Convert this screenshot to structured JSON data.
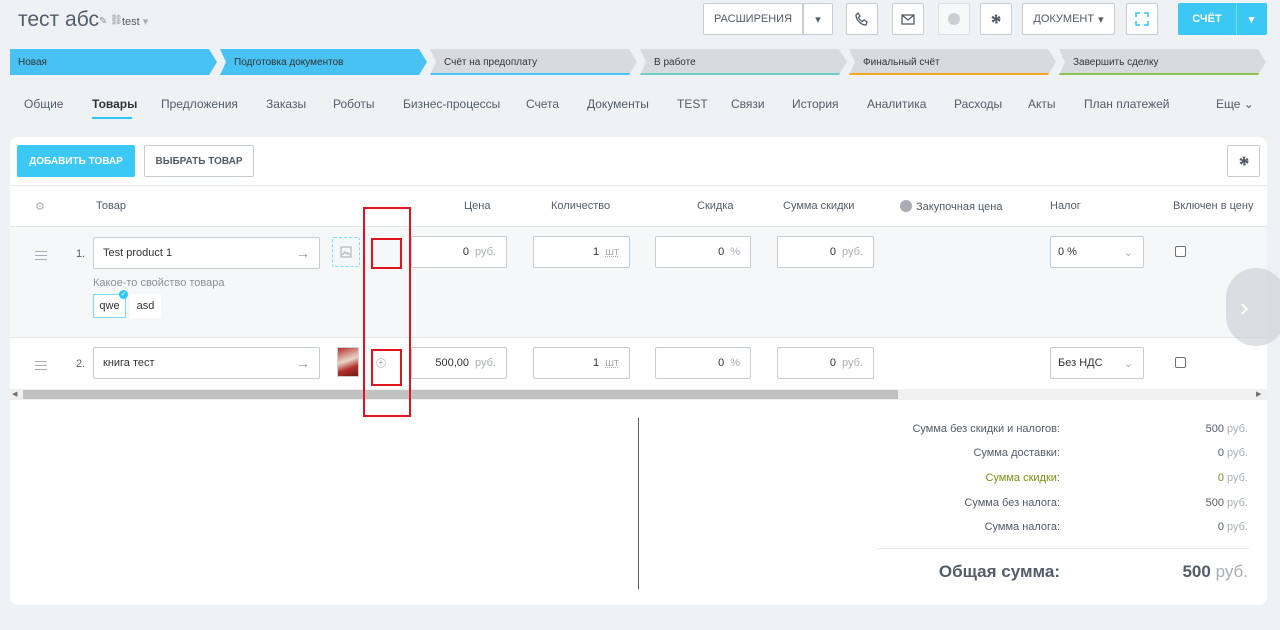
{
  "header": {
    "title": "тест абс",
    "category": "test",
    "extensions_label": "РАСШИРЕНИЯ",
    "document_label": "ДОКУМЕНТ",
    "invoice_label": "СЧЁТ"
  },
  "stages": [
    {
      "label": "Новая",
      "color": "#47c2f3"
    },
    {
      "label": "Подготовка документов",
      "color": "#47c2f3"
    },
    {
      "label": "Счёт на предоплату",
      "color": "#d7dbe0"
    },
    {
      "label": "В работе",
      "color": "#d7dbe0"
    },
    {
      "label": "Финальный счёт",
      "color": "#d7dbe0"
    },
    {
      "label": "Завершить сделку",
      "color": "#d7dbe0"
    }
  ],
  "tabs": [
    "Общие",
    "Товары",
    "Предложения",
    "Заказы",
    "Роботы",
    "Бизнес-процессы",
    "Счета",
    "Документы",
    "TEST",
    "Связи",
    "История",
    "Аналитика",
    "Расходы",
    "Акты",
    "План платежей"
  ],
  "more_tab": "Еще",
  "toolbar": {
    "add_product": "ДОБАВИТЬ ТОВАР",
    "select_product": "ВЫБРАТЬ ТОВАР"
  },
  "columns": {
    "product": "Товар",
    "price": "Цена",
    "quantity": "Количество",
    "discount": "Скидка",
    "discount_sum": "Сумма скидки",
    "purchase_price": "Закупочная цена",
    "tax": "Налог",
    "included": "Включен в цену"
  },
  "rows": [
    {
      "num": "1.",
      "name": "Test product 1",
      "property_label": "Какое-то свойство товара",
      "options": [
        "qwe",
        "asd"
      ],
      "price": "0",
      "price_unit": "руб.",
      "qty": "1",
      "qty_unit": "шт",
      "discount": "0",
      "discount_unit": "%",
      "discount_sum": "0",
      "discount_sum_unit": "руб.",
      "tax": "0 %"
    },
    {
      "num": "2.",
      "name": "книга тест",
      "price": "500,00",
      "price_unit": "руб.",
      "qty": "1",
      "qty_unit": "шт",
      "discount": "0",
      "discount_unit": "%",
      "discount_sum": "0",
      "discount_sum_unit": "руб.",
      "tax": "Без НДС"
    }
  ],
  "summary": {
    "items": [
      {
        "label": "Сумма без скидки и налогов:",
        "value": "500",
        "unit": "руб."
      },
      {
        "label": "Сумма доставки:",
        "value": "0",
        "unit": "руб."
      },
      {
        "label": "Сумма скидки:",
        "value": "0",
        "unit": "руб."
      },
      {
        "label": "Сумма без налога:",
        "value": "500",
        "unit": "руб."
      },
      {
        "label": "Сумма налога:",
        "value": "0",
        "unit": "руб."
      }
    ],
    "total_label": "Общая сумма:",
    "total_value": "500",
    "total_unit": "руб."
  },
  "colors": {
    "accent": "#3bc8f5",
    "discount_green": "#7b8e0f",
    "annotation_red": "#e0141e"
  }
}
